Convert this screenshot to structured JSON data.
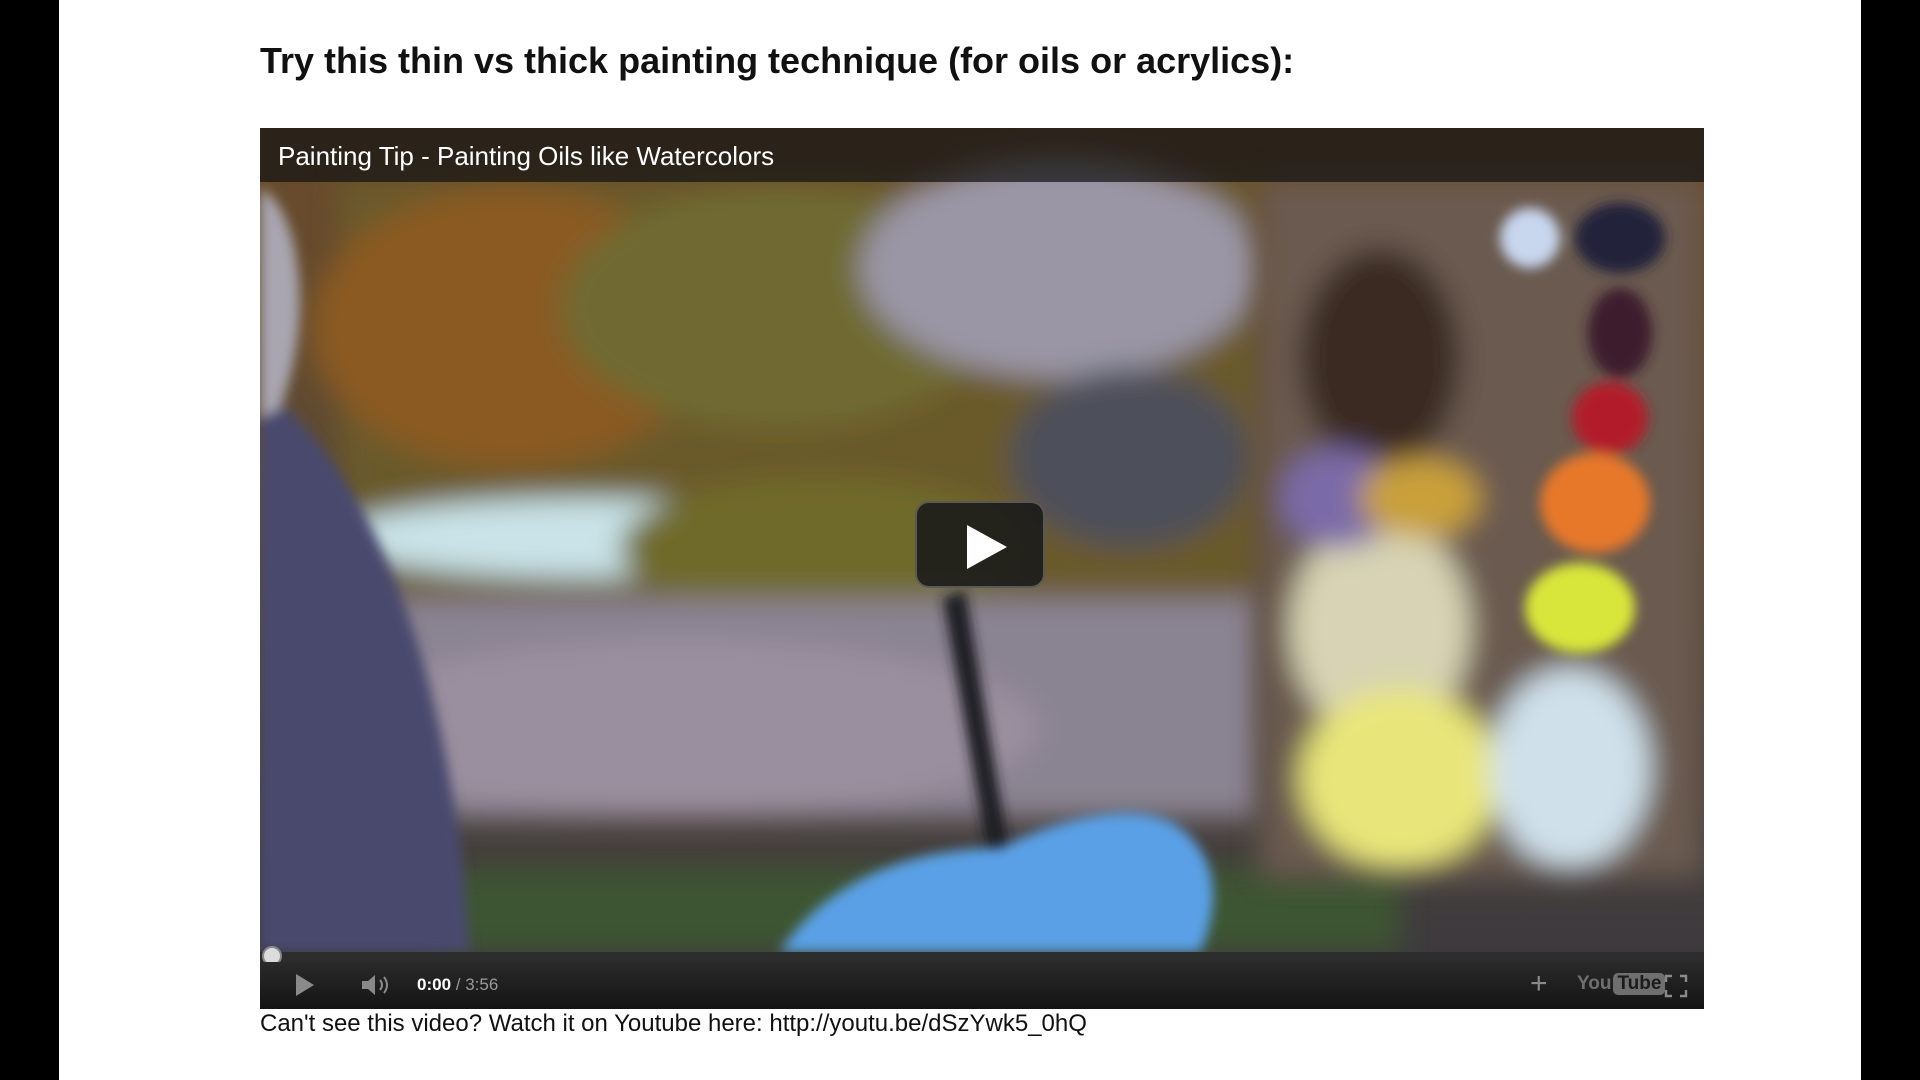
{
  "page": {
    "heading": "Try this thin vs thick painting technique (for oils or acrylics):",
    "caption_prefix": "Can't see this video? Watch it on Youtube here: ",
    "caption_link": "http://youtu.be/dSzYwk5_0hQ"
  },
  "player": {
    "title": "Painting Tip - Painting Oils like Watercolors",
    "current_time": "0:00",
    "separator": " / ",
    "duration": "3:56",
    "progress": 0,
    "logo_you": "You",
    "logo_tube": "Tube",
    "icons": {
      "big_play": "play-icon",
      "play": "play-icon",
      "volume": "volume-icon",
      "add": "plus-icon",
      "fullscreen": "fullscreen-icon"
    }
  },
  "colors": {
    "accent": "#c4302b",
    "control_bar": "#1b1b1b",
    "page_background": "#ffffff",
    "frame": "#000000"
  }
}
